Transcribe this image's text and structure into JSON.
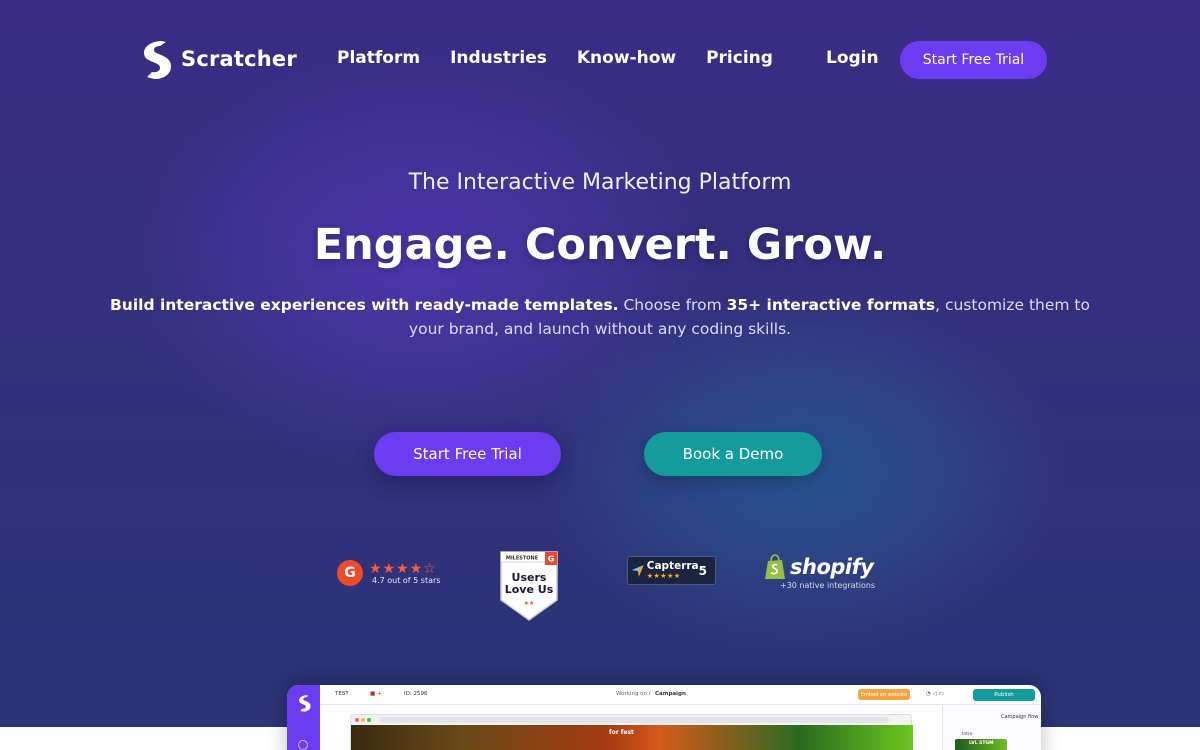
{
  "brand": {
    "name": "Scratcher",
    "primary_color": "#6b3cf2",
    "teal_color": "#149c9c"
  },
  "nav": {
    "items": [
      "Platform",
      "Industries",
      "Know-how",
      "Pricing"
    ],
    "login": "Login",
    "cta": "Start Free Trial"
  },
  "hero": {
    "eyebrow": "The Interactive Marketing Platform",
    "headline": "Engage. Convert. Grow.",
    "sub_part1": "Build interactive experiences with ready-made templates.",
    "sub_part2": " Choose from ",
    "sub_part3": "35+ interactive formats",
    "sub_part4": ", customize them to your brand, and launch without any coding skills."
  },
  "cta": {
    "trial": "Start Free Trial",
    "demo": "Book a Demo"
  },
  "badges": {
    "g2": {
      "logo": "G",
      "stars": "★★★★☆",
      "rating": 4.7,
      "caption": "4.7 out of 5 stars"
    },
    "milestone": {
      "top": "MILESTONE",
      "line1": "Users",
      "line2": "Love Us",
      "stars": "★★",
      "logo": "G"
    },
    "capterra": {
      "name": "Capterra",
      "stars": "★★★★★",
      "score": "5"
    },
    "shopify": {
      "name": "shopify",
      "caption": "+30 native integrations"
    }
  },
  "preview": {
    "project": "TEST",
    "id": "ID: 2596",
    "breadcrumb_prefix": "Working on /",
    "breadcrumb_current": "Campaign",
    "embed": "Embed on website",
    "publish": "Publish",
    "panel_title": "Campaign flow",
    "panel_intro": "Intro",
    "canvas_title": "for fest",
    "thumb_text": "LVL STGM"
  }
}
